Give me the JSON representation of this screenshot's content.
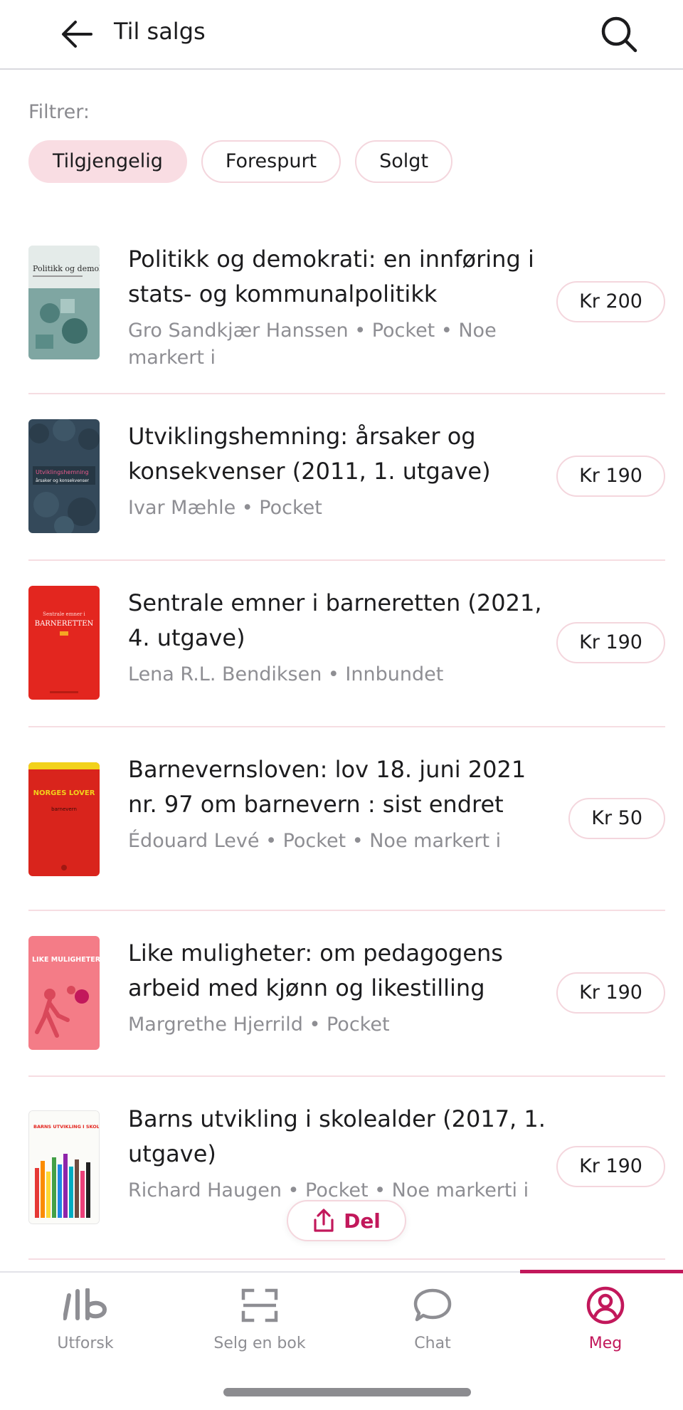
{
  "header": {
    "title": "Til salgs",
    "back_icon": "arrow-left-icon",
    "search_icon": "search-icon"
  },
  "filters": {
    "label": "Filtrer:",
    "chips": [
      {
        "label": "Tilgjengelig",
        "active": true
      },
      {
        "label": "Forespurt",
        "active": false
      },
      {
        "label": "Solgt",
        "active": false
      }
    ]
  },
  "listings": [
    {
      "title": "Politikk og demokrati: en innføring i stats- og kommunalpolitikk",
      "meta": "Gro Sandkjær Hanssen • Pocket • Noe markert i",
      "price": "Kr 200"
    },
    {
      "title": "Utviklingshemning: årsaker og konsekvenser (2011, 1. utgave)",
      "meta": "Ivar Mæhle • Pocket",
      "price": "Kr 190"
    },
    {
      "title": "Sentrale emner i barneretten (2021, 4. utgave)",
      "meta": "Lena R.L. Bendiksen • Innbundet",
      "price": "Kr 190"
    },
    {
      "title": "Barnevernsloven: lov 18. juni 2021 nr. 97 om barnevern : sist endret",
      "meta": "Édouard Levé • Pocket • Noe markert i",
      "price": "Kr 50"
    },
    {
      "title": "Like muligheter: om pedagogens arbeid med kjønn og likestilling",
      "meta": "Margrethe Hjerrild • Pocket",
      "price": "Kr 190"
    },
    {
      "title": "Barns utvikling i skolealder (2017, 1. utgave)",
      "meta": "Richard Haugen • Pocket • Noe markerti i",
      "price": "Kr 190"
    }
  ],
  "covers": [
    {
      "title": "Politikk og demokrati",
      "bg": "#dfe6e4"
    },
    {
      "title": "Utviklingshemning",
      "subtitle": "årsaker og konsekvenser",
      "bg": "#34495a"
    },
    {
      "title": "BARNERETTEN",
      "subtitle": "Sentrale emner i",
      "bg": "#e3261f"
    },
    {
      "title": "NORGES LOVER",
      "subtitle": "barnevern",
      "bg": "#d9241c"
    },
    {
      "title": "LIKE MULIGHETER",
      "bg": "#f47c87"
    },
    {
      "title": "BARNS UTVIKLING I SKOLEALDER",
      "bg": "#fbfbf8"
    }
  ],
  "share": {
    "label": "Del",
    "icon": "share-icon"
  },
  "nav": {
    "active_color": "#c2185b",
    "items": [
      {
        "label": "Utforsk",
        "icon": "lb-logo-icon"
      },
      {
        "label": "Selg en bok",
        "icon": "scan-icon"
      },
      {
        "label": "Chat",
        "icon": "chat-bubble-icon"
      },
      {
        "label": "Meg",
        "icon": "user-circle-icon"
      }
    ]
  }
}
